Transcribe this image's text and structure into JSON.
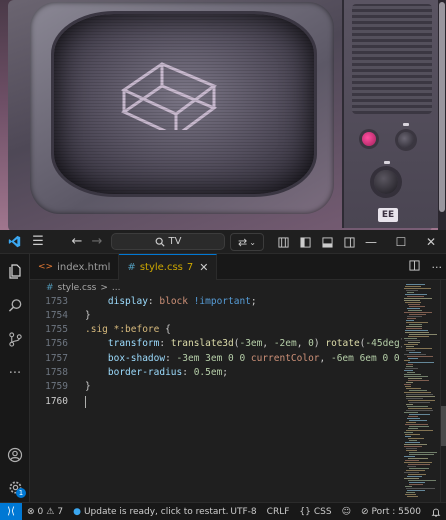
{
  "preview": {
    "brand_text": "EE"
  },
  "titlebar": {
    "search_text": "TV"
  },
  "tabs": [
    {
      "label": "index.html"
    },
    {
      "label": "style.css",
      "problems": "7"
    }
  ],
  "breadcrumb": {
    "file": "style.css",
    "separator": ">",
    "rest": "..."
  },
  "editor": {
    "lines": [
      {
        "number": "1753",
        "parts": [
          [
            "d-prop",
            "    display"
          ],
          [
            "p",
            ": "
          ],
          [
            "v",
            "block "
          ],
          [
            "i",
            "!important"
          ],
          [
            "p",
            ";"
          ]
        ]
      },
      {
        "number": "1754",
        "parts": [
          [
            "p",
            "}"
          ]
        ]
      },
      {
        "number": "1755",
        "parts": [
          [
            "s",
            ".sig *:before "
          ],
          [
            "p",
            "{"
          ]
        ]
      },
      {
        "number": "1756",
        "parts": [
          [
            "d-prop",
            "    transform"
          ],
          [
            "p",
            ": "
          ],
          [
            "f",
            "translate3d"
          ],
          [
            "p",
            "("
          ],
          [
            "n",
            "-3em"
          ],
          [
            "p",
            ", "
          ],
          [
            "n",
            "-2em"
          ],
          [
            "p",
            ", "
          ],
          [
            "n",
            "0"
          ],
          [
            "p",
            ") "
          ],
          [
            "f",
            "rotate"
          ],
          [
            "p",
            "("
          ],
          [
            "n",
            "-45deg"
          ],
          [
            "p",
            ");"
          ]
        ]
      },
      {
        "number": "1757",
        "parts": [
          [
            "d-prop",
            "    box-shadow"
          ],
          [
            "p",
            ": "
          ],
          [
            "n",
            "-3em 3em 0 0 "
          ],
          [
            "v",
            "currentColor"
          ],
          [
            "p",
            ", "
          ],
          [
            "n",
            "-6em 6em 0 0 "
          ],
          [
            "v",
            "cur"
          ]
        ]
      },
      {
        "number": "1758",
        "parts": [
          [
            "d-prop",
            "    border-radius"
          ],
          [
            "p",
            ": "
          ],
          [
            "n",
            "0.5em"
          ],
          [
            "p",
            ";"
          ]
        ]
      },
      {
        "number": "1759",
        "parts": [
          [
            "p",
            "}"
          ]
        ]
      },
      {
        "number": "1760",
        "parts": []
      }
    ]
  },
  "statusbar": {
    "errors": "0",
    "warnings": "7",
    "update_msg": "Update is ready, click to restart.",
    "encoding": "UTF-8",
    "eol": "CRLF",
    "language": "CSS",
    "port": "Port : 5500"
  },
  "activity": {
    "settings_badge": "1"
  },
  "colors": {
    "accent": "#0078d4",
    "editor_bg": "#1f1f1f"
  }
}
